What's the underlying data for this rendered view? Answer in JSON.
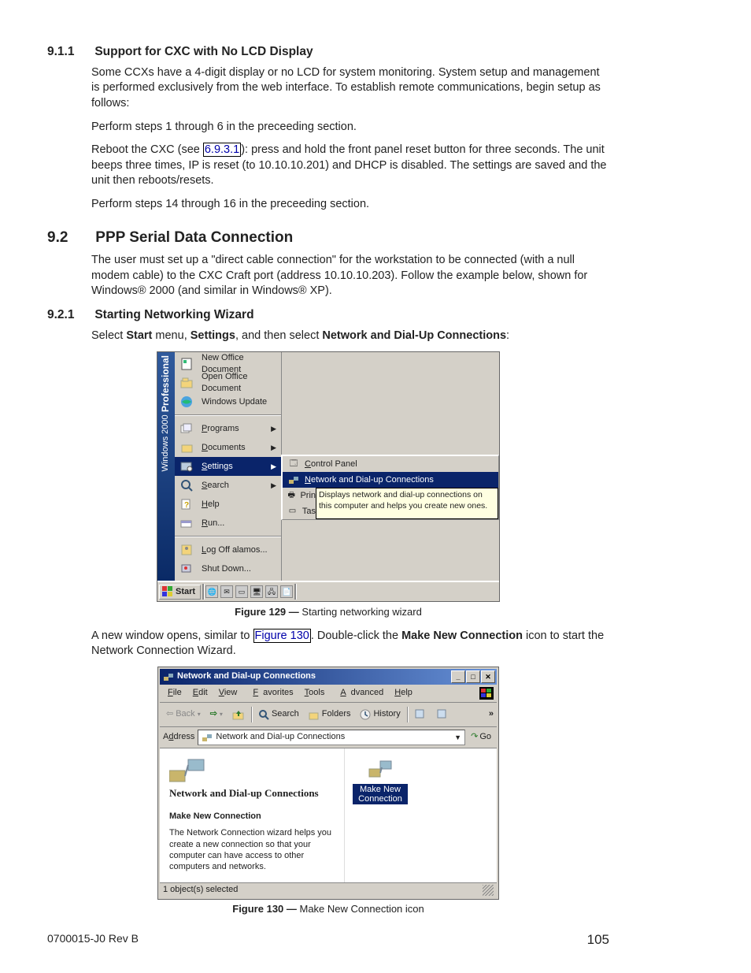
{
  "sec911": {
    "num": "9.1.1",
    "title": "Support for CXC with No LCD Display"
  },
  "p1": "Some CCXs have a 4-digit display or no LCD for system monitoring. System setup and management is performed exclusively from the web interface. To establish remote communications, begin setup as follows:",
  "p2": "Perform steps 1 through 6 in the preceeding section.",
  "p3a": "Reboot the CXC (see ",
  "p3link": "6.9.3.1",
  "p3b": "): press and hold the front panel reset button for three seconds. The unit beeps three times, IP is reset (to 10.10.10.201) and DHCP is disabled. The settings are saved and the unit then reboots/resets.",
  "p4": "Perform steps 14 through 16 in the preceeding section.",
  "sec92": {
    "num": "9.2",
    "title": "PPP Serial Data Connection"
  },
  "p5": "The user must set up a \"direct cable connection\" for the workstation to be connected (with a null modem cable) to the CXC Craft port (address 10.10.10.203). Follow the example below, shown for Windows® 2000 (and similar in Windows® XP).",
  "sec921": {
    "num": "9.2.1",
    "title": "Starting Networking Wizard"
  },
  "p6a": "Select ",
  "p6b": "Start",
  "p6c": " menu, ",
  "p6d": "Settings",
  "p6e": ", and then select ",
  "p6f": "Network and Dial-Up Connections",
  "p6g": ":",
  "start": {
    "banner_bold": "Professional",
    "banner_light": "Windows 2000",
    "items_top": [
      "New Office Document",
      "Open Office Document",
      "Windows Update"
    ],
    "items_main": [
      "Programs",
      "Documents",
      "Settings",
      "Search",
      "Help",
      "Run..."
    ],
    "items_bottom": [
      "Log Off alamos...",
      "Shut Down..."
    ],
    "sub_settings": [
      "Control Panel",
      "Network and Dial-up Connections",
      "Printers",
      "Taskbar & Start Menu..."
    ],
    "tooltip": "Displays network and dial-up connections on this computer and helps you create new ones.",
    "start_btn": "Start"
  },
  "fig129": {
    "label": "Figure 129  —",
    "text": "  Starting networking wizard"
  },
  "p7a": "A new window opens, similar to ",
  "p7link": "Figure 130",
  "p7b": ". Double-click the ",
  "p7c": "Make New Connection",
  "p7d": " icon to start the Network Connection Wizard.",
  "win": {
    "title": "Network and Dial-up Connections",
    "menus": [
      "File",
      "Edit",
      "View",
      "Favorites",
      "Tools",
      "Advanced",
      "Help"
    ],
    "back": "Back",
    "search": "Search",
    "folders": "Folders",
    "history": "History",
    "address_lbl": "Address",
    "address_val": "Network and Dial-up Connections",
    "go": "Go",
    "left_title": "Network and Dial-up Connections",
    "left_head": "Make New Connection",
    "left_desc": "The Network Connection wizard helps you create a new connection so that your computer can have access to other computers and networks.",
    "icon_label": "Make New Connection",
    "status": "1 object(s) selected"
  },
  "fig130": {
    "label": "Figure 130  —",
    "text": "  Make New Connection icon"
  },
  "footer": {
    "left": "0700015-J0    Rev B",
    "page": "105"
  }
}
